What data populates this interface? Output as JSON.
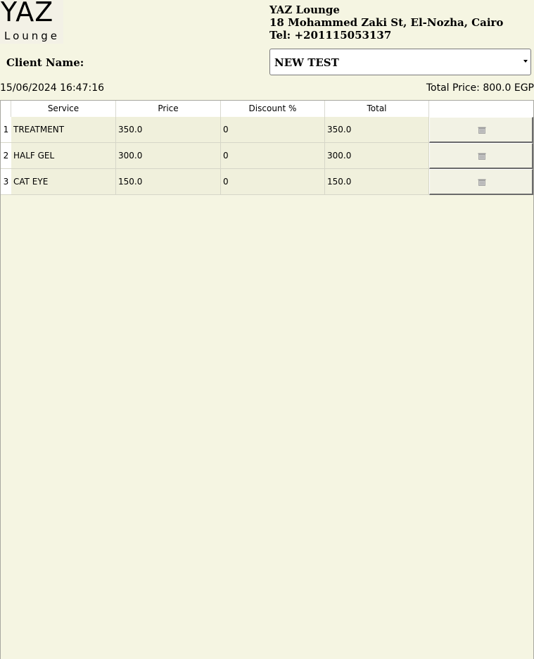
{
  "logo": {
    "main": "YAZ",
    "sub": "Lounge"
  },
  "business": {
    "name": "YAZ Lounge",
    "address": "18 Mohammed Zaki St, El-Nozha, Cairo",
    "phone": "Tel: +201115053137"
  },
  "client": {
    "label": "Client Name:",
    "value": "NEW TEST"
  },
  "datetime": "15/06/2024 16:47:16",
  "total_price": "Total Price: 800.0 EGP",
  "table": {
    "headers": [
      "Service",
      "Price",
      "Discount %",
      "Total",
      ""
    ],
    "rows": [
      {
        "num": "1",
        "service": "TREATMENT",
        "price": "350.0",
        "discount": "0",
        "total": "350.0"
      },
      {
        "num": "2",
        "service": "HALF GEL",
        "price": "300.0",
        "discount": "0",
        "total": "300.0"
      },
      {
        "num": "3",
        "service": "CAT EYE",
        "price": "150.0",
        "discount": "0",
        "total": "150.0"
      }
    ]
  },
  "icons": {
    "delete": "trash-icon",
    "dropdown": "chevron-down-icon"
  }
}
